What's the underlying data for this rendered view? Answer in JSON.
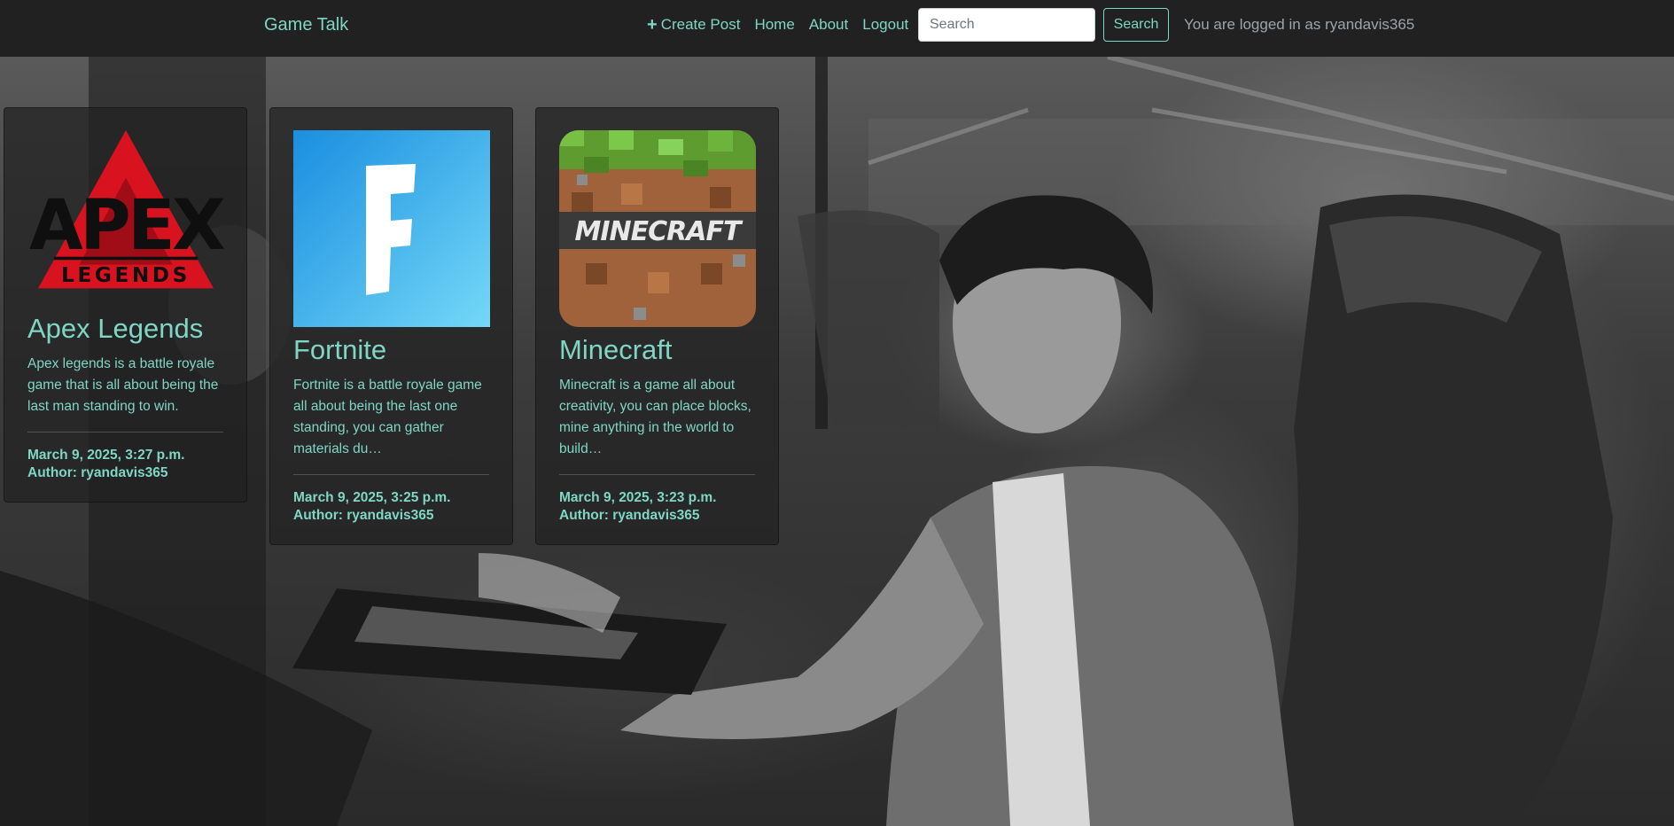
{
  "navbar": {
    "brand": "Game Talk",
    "links": [
      {
        "label": "Create Post",
        "icon": "plus-icon"
      },
      {
        "label": "Home"
      },
      {
        "label": "About"
      },
      {
        "label": "Logout"
      }
    ],
    "search": {
      "placeholder": "Search",
      "value": "",
      "button_label": "Search"
    },
    "login_status": "You are logged in as ryandavis365"
  },
  "theme": {
    "accent": "#7fd6c5",
    "navbar_bg": "#212121",
    "card_bg": "#212121"
  },
  "posts": [
    {
      "title": "Apex Legends",
      "image_icon": "apex-legends-logo",
      "description": "Apex legends is a battle royale game that is all about being the last man standing to win.",
      "date": "March 9, 2025, 3:27 p.m.",
      "author": "Author: ryandavis365"
    },
    {
      "title": "Fortnite",
      "image_icon": "fortnite-logo",
      "description": "Fortnite is a battle royale game all about being the last one standing, you can gather materials du…",
      "date": "March 9, 2025, 3:25 p.m.",
      "author": "Author: ryandavis365"
    },
    {
      "title": "Minecraft",
      "image_icon": "minecraft-logo",
      "description": "Minecraft is a game all about creativity, you can place blocks, mine anything in the world to build…",
      "date": "March 9, 2025, 3:23 p.m.",
      "author": "Author: ryandavis365"
    }
  ]
}
